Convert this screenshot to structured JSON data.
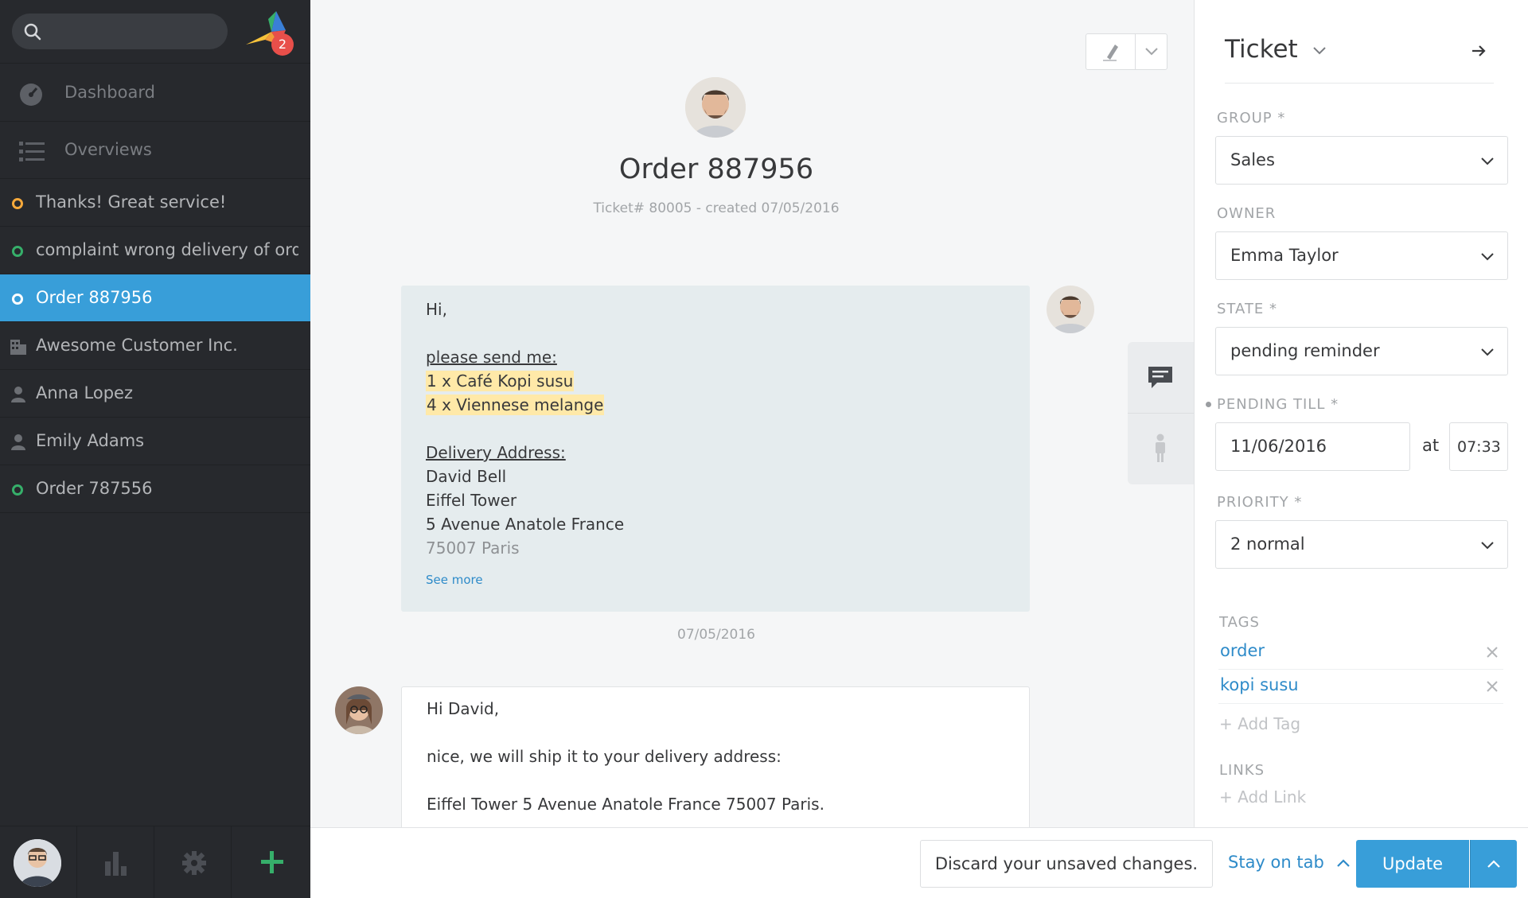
{
  "search": {
    "placeholder": ""
  },
  "notifications": {
    "count": "2"
  },
  "nav": [
    {
      "label": "Dashboard",
      "icon": "dashboard-icon"
    },
    {
      "label": "Overviews",
      "icon": "list-icon"
    }
  ],
  "tasks": [
    {
      "label": "Thanks! Great service!",
      "status_color": "#f6a93b",
      "icon": "ticket-status-icon"
    },
    {
      "label": "complaint wrong delivery of ord...",
      "status_color": "#36af6a",
      "icon": "ticket-status-icon"
    },
    {
      "label": "Order 887956",
      "status_color": "#ffffff",
      "icon": "ticket-status-icon",
      "active": true
    },
    {
      "label": "Awesome Customer Inc.",
      "icon": "organization-icon"
    },
    {
      "label": "Anna Lopez",
      "icon": "user-icon"
    },
    {
      "label": "Emily Adams",
      "icon": "user-icon"
    },
    {
      "label": "Order 787556",
      "status_color": "#36af6a",
      "icon": "ticket-status-icon"
    }
  ],
  "ticket": {
    "title": "Order 887956",
    "subtitle": "Ticket# 80005 - created 07/05/2016"
  },
  "articles": {
    "customer": {
      "lines": [
        "Hi,",
        "please send me:",
        "1 x Café Kopi susu",
        "4 x Viennese melange",
        "Delivery Address:",
        "David Bell",
        "Eiffel Tower",
        "5 Avenue Anatole France",
        "75007 Paris"
      ],
      "see_more": "See more",
      "date": "07/05/2016"
    },
    "agent": {
      "lines": [
        "Hi David,",
        "nice, we will ship it to your delivery address:",
        "Eiffel Tower 5 Avenue Anatole France 75007 Paris."
      ]
    }
  },
  "panel": {
    "title": "Ticket",
    "group_label": "GROUP *",
    "group_value": "Sales",
    "owner_label": "OWNER",
    "owner_value": "Emma Taylor",
    "state_label": "STATE *",
    "state_value": "pending reminder",
    "pending_label": "PENDING TILL *",
    "pending_date": "11/06/2016",
    "pending_at": "at",
    "pending_time": "07:33",
    "priority_label": "PRIORITY *",
    "priority_value": "2 normal",
    "tags_label": "TAGS",
    "tags": [
      "order",
      "kopi susu"
    ],
    "add_tag": "+ Add Tag",
    "links_label": "LINKS",
    "add_link": "+ Add Link"
  },
  "footer": {
    "discard": "Discard your unsaved changes.",
    "stay": "Stay on tab",
    "update": "Update"
  },
  "colors": {
    "accent": "#389ed9",
    "sidebar": "#27292d",
    "link": "#2e8bc9"
  }
}
